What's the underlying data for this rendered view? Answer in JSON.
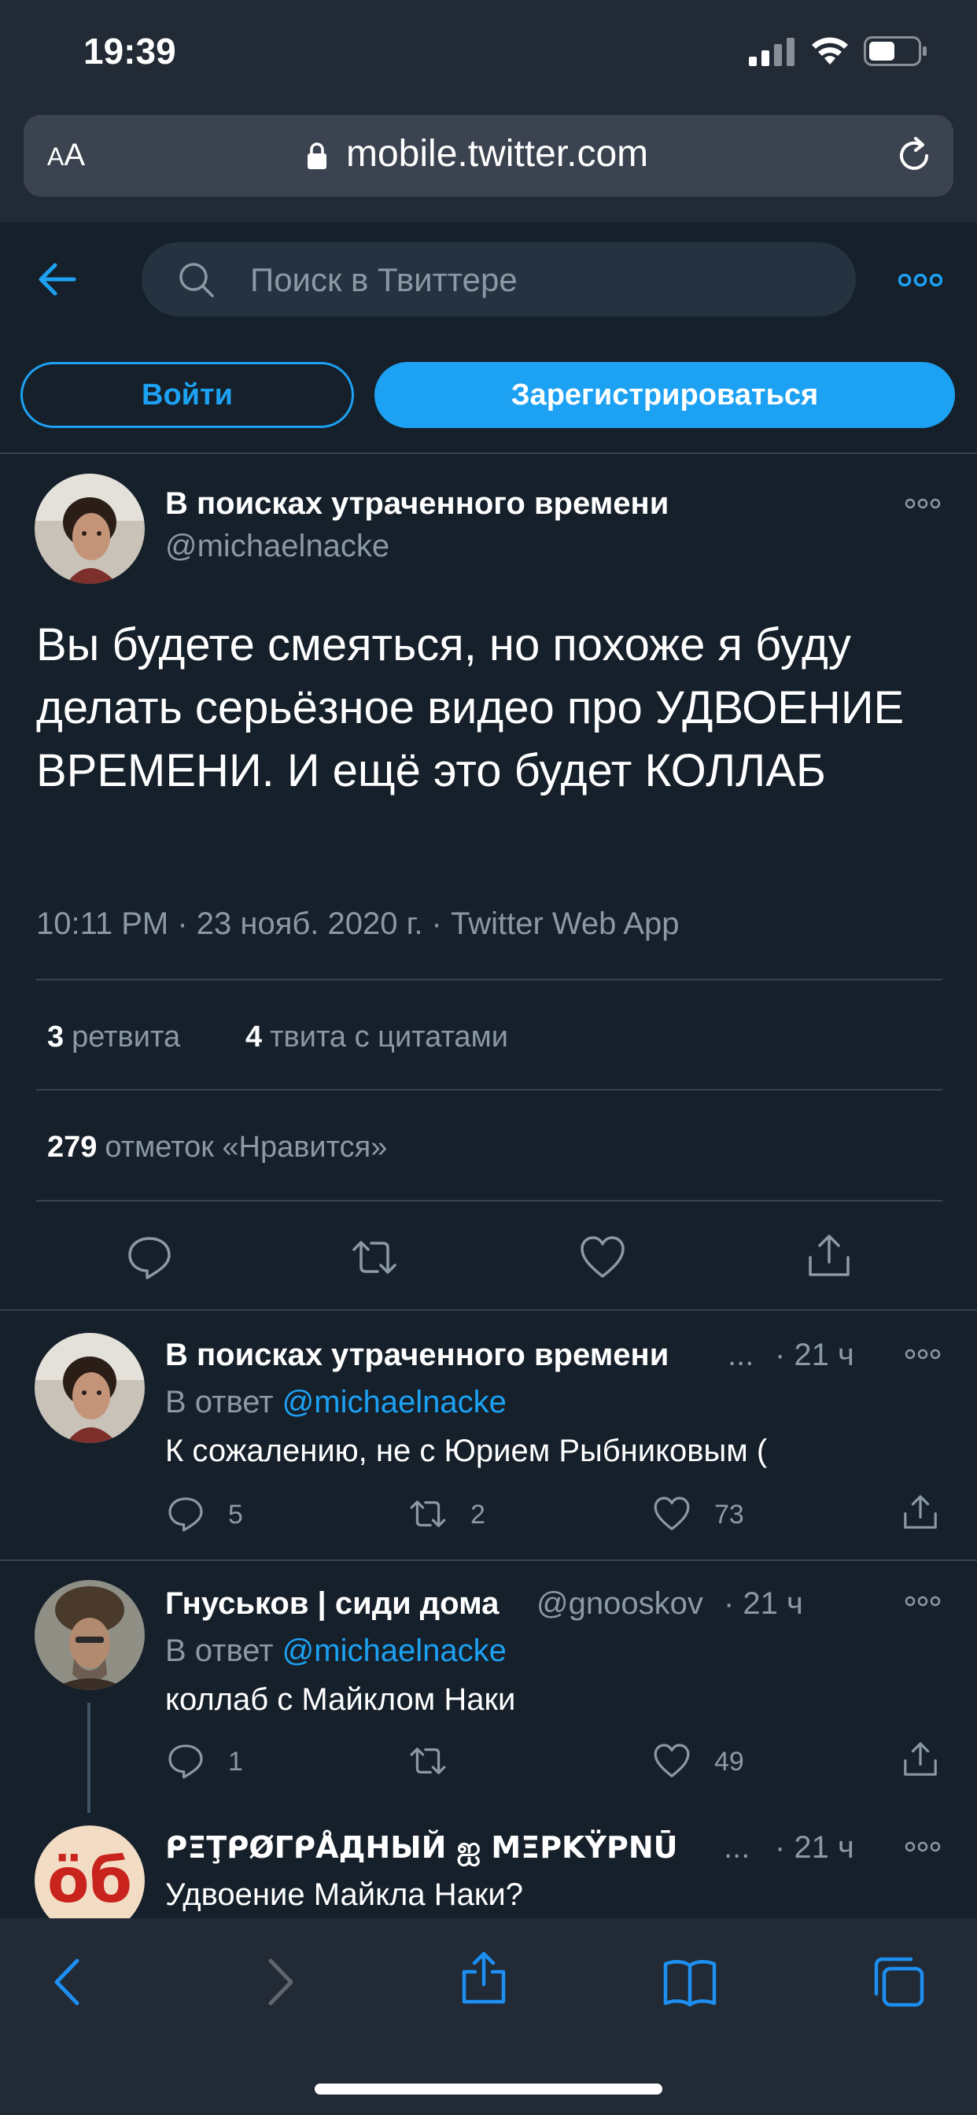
{
  "status_bar": {
    "time": "19:39"
  },
  "browser": {
    "text_size_small": "A",
    "text_size_large": "A",
    "url": "mobile.twitter.com"
  },
  "header": {
    "search_placeholder": "Поиск в Твиттере",
    "login_label": "Войти",
    "signup_label": "Зарегистрироваться"
  },
  "tweet": {
    "author_name": "В поисках утраченного времени",
    "author_handle": "@michaelnacke",
    "text": "Вы будете смеяться, но похоже я буду делать серьёзное видео про УДВОЕНИЕ ВРЕМЕНИ. И ещё это будет КОЛЛАБ",
    "meta": "10:11 PM · 23 нояб. 2020 г. · Twitter Web App",
    "retweets_count": "3",
    "retweets_label": "ретвита",
    "quotes_count": "4",
    "quotes_label": "твита с цитатами",
    "likes_count": "279",
    "likes_label": "отметок «Нравится»"
  },
  "replies": [
    {
      "name": "В поисках утраченного времени",
      "ellipsis": "...",
      "time": "· 21 ч",
      "reply_prefix": "В ответ",
      "reply_to": "@michaelnacke",
      "text": "К сожалению, не с Юрием Рыбниковым (",
      "reply_count": "5",
      "retweet_count": "2",
      "like_count": "73"
    },
    {
      "name": "Гнуськов | сиди дома",
      "handle": "@gnooskov",
      "time": "· 21 ч",
      "reply_prefix": "В ответ",
      "reply_to": "@michaelnacke",
      "text": "коллаб с Майклом Наки",
      "reply_count": "1",
      "retweet_count": "",
      "like_count": "49"
    },
    {
      "name": "ᑭΞŢᑭØΓᑭÅДНЫЙ ஐ MΞPKŸPNŪ",
      "ellipsis": "...",
      "time": "· 21 ч",
      "text": "Удвоение Майкла Наки?",
      "avatar_text": "öб"
    }
  ],
  "colors": {
    "background": "#15202b",
    "accent": "#1da1f2",
    "secondary_text": "#8b98a5",
    "divider": "#38444d",
    "browser_chrome": "#222a35"
  }
}
